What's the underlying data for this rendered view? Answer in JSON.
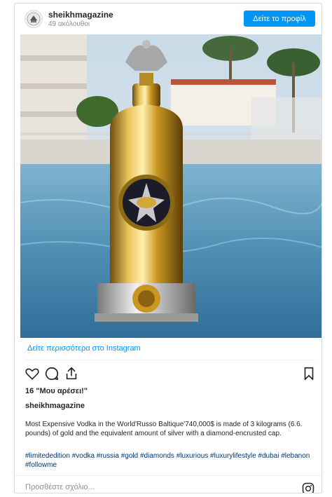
{
  "header": {
    "username": "sheikhmagazine",
    "followers": "49 ακόλουθοι",
    "profile_button": "Δείτε το προφίλ"
  },
  "post": {
    "image_icon": "vodka-bottle-photo",
    "more_link": "Δείτε περισσότερα στο Instagram",
    "likes": "16 \"Μου αρέσει!\"",
    "caption_username": "sheikhmagazine",
    "caption": "Most Expensive Vodka in the World'Russo Baltique'740,000$ is made of 3 kilograms (6.6. pounds) of gold and the equivalent amount of silver with a diamond-encrusted cap.",
    "hashtags": "#limitededition #vodka #russia #gold #diamonds #luxurious #luxurylifestyle #dubai #lebanon #followme"
  },
  "footer": {
    "comment_placeholder": "Προσθέστε σχόλιο...",
    "icon": "instagram-icon"
  },
  "colors": {
    "accent": "#0095f6",
    "hashtag": "#00376b",
    "border": "#dbdbdb"
  }
}
